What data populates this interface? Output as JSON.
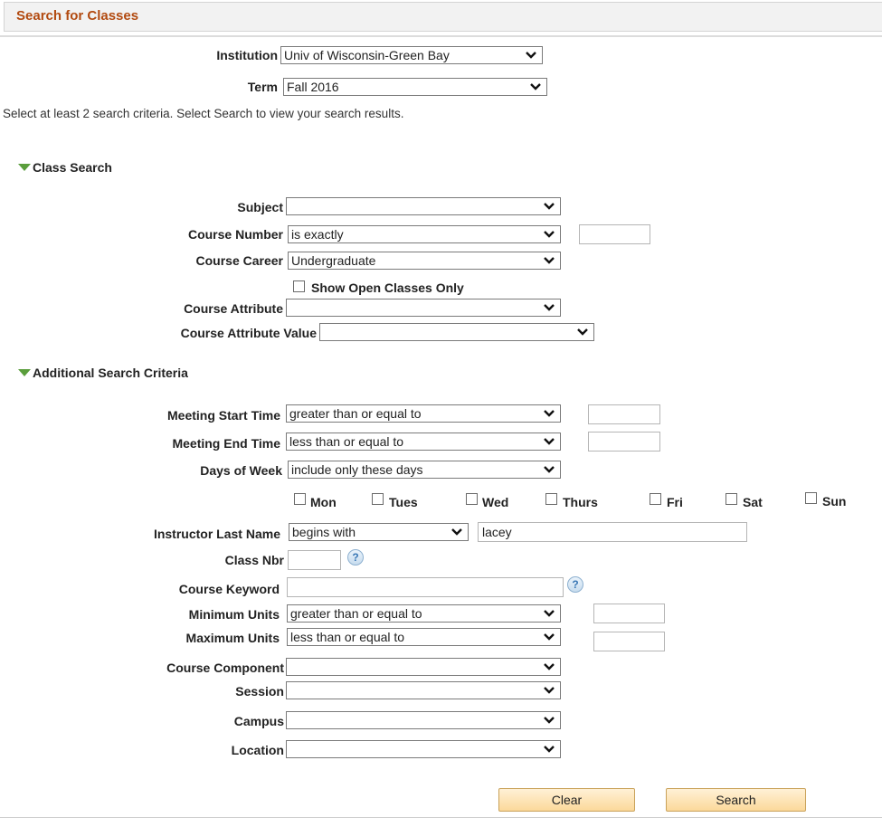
{
  "header": {
    "title": "Search for Classes"
  },
  "institution": {
    "label": "Institution",
    "value": "Univ of Wisconsin-Green Bay"
  },
  "term": {
    "label": "Term",
    "value": "Fall 2016"
  },
  "instructions": "Select at least 2 search criteria. Select Search to view your search results.",
  "class_search": {
    "title": "Class Search",
    "subject": {
      "label": "Subject",
      "value": ""
    },
    "course_number": {
      "label": "Course Number",
      "operator": "is exactly",
      "value": ""
    },
    "course_career": {
      "label": "Course Career",
      "value": "Undergraduate"
    },
    "show_open": {
      "label": "Show Open Classes Only",
      "checked": false
    },
    "course_attribute": {
      "label": "Course Attribute",
      "value": ""
    },
    "course_attribute_value": {
      "label": "Course Attribute Value",
      "value": ""
    }
  },
  "additional": {
    "title": "Additional Search Criteria",
    "meeting_start": {
      "label": "Meeting Start Time",
      "operator": "greater than or equal to",
      "value": ""
    },
    "meeting_end": {
      "label": "Meeting End Time",
      "operator": "less than or equal to",
      "value": ""
    },
    "days_of_week": {
      "label": "Days of Week",
      "operator": "include only these days"
    },
    "days": [
      "Mon",
      "Tues",
      "Wed",
      "Thurs",
      "Fri",
      "Sat",
      "Sun"
    ],
    "instructor": {
      "label": "Instructor Last Name",
      "operator": "begins with",
      "value": "lacey"
    },
    "class_nbr": {
      "label": "Class Nbr",
      "value": ""
    },
    "course_keyword": {
      "label": "Course Keyword",
      "value": ""
    },
    "min_units": {
      "label": "Minimum Units",
      "operator": "greater than or equal to",
      "value": ""
    },
    "max_units": {
      "label": "Maximum Units",
      "operator": "less than or equal to",
      "value": ""
    },
    "course_component": {
      "label": "Course Component",
      "value": ""
    },
    "session": {
      "label": "Session",
      "value": ""
    },
    "campus": {
      "label": "Campus",
      "value": ""
    },
    "location": {
      "label": "Location",
      "value": ""
    }
  },
  "buttons": {
    "clear": "Clear",
    "search": "Search"
  },
  "icons": {
    "help": "help-icon",
    "chevron": "chevron-down-icon",
    "expand": "expand-triangle-icon"
  },
  "colors": {
    "title": "#b24a10",
    "triangle": "#5a9e3c",
    "button": "#fbd99a"
  }
}
